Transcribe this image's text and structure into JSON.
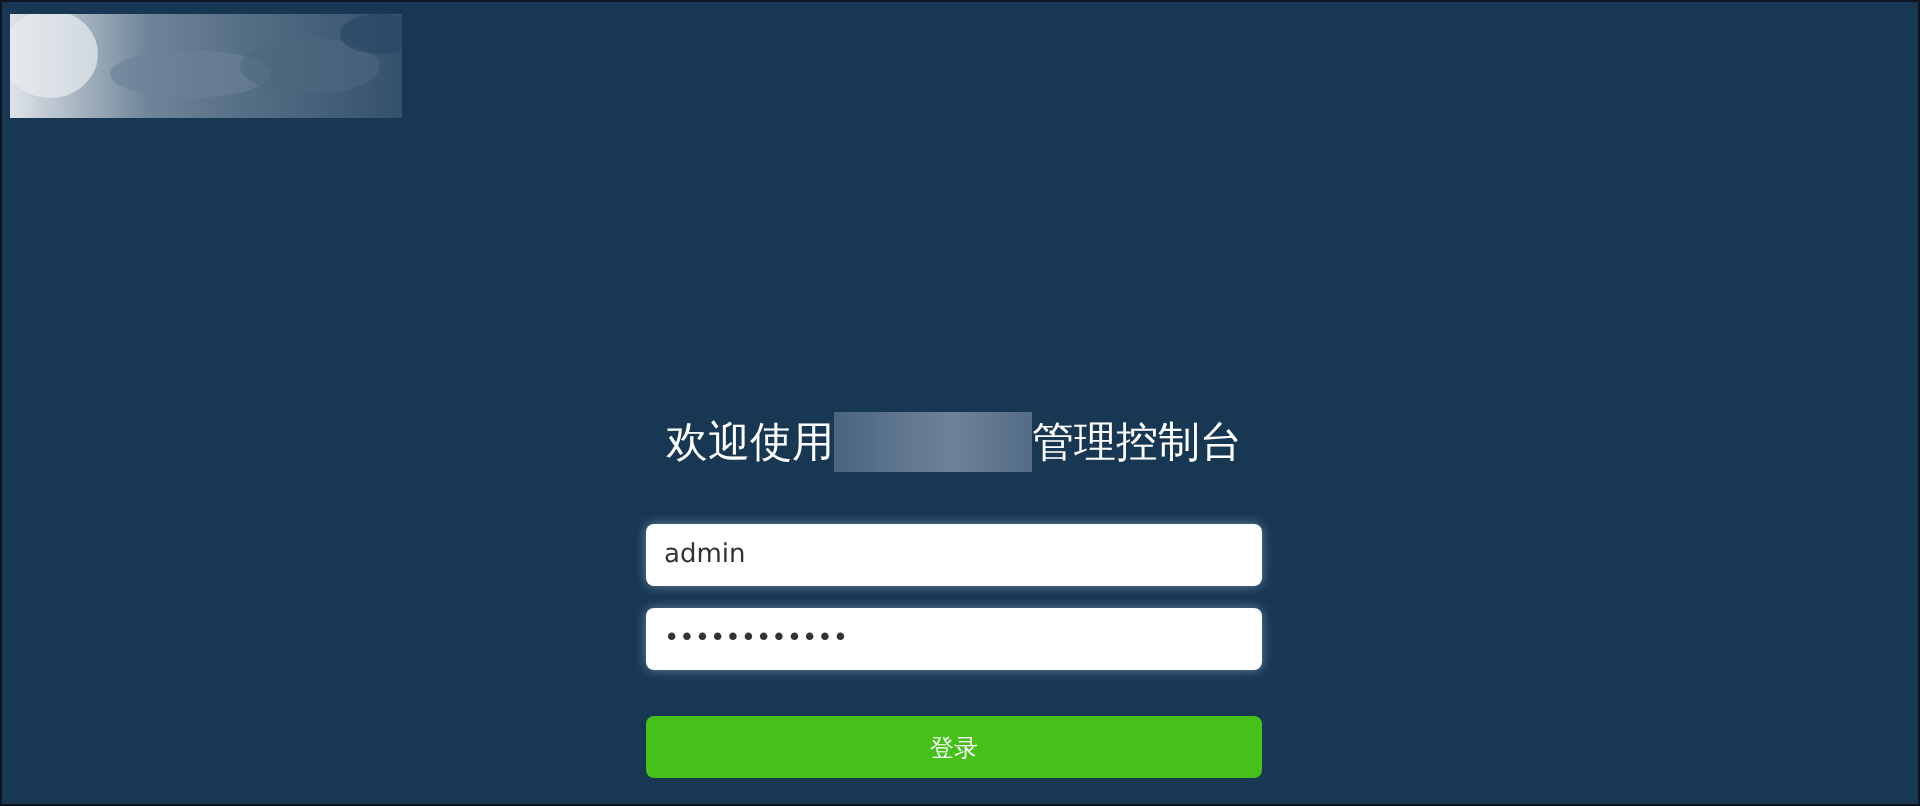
{
  "heading": {
    "before": "欢迎使用",
    "after": "管理控制台"
  },
  "form": {
    "username": {
      "value": "admin"
    },
    "password": {
      "value": "••••••••••••"
    },
    "submit": "登录"
  }
}
